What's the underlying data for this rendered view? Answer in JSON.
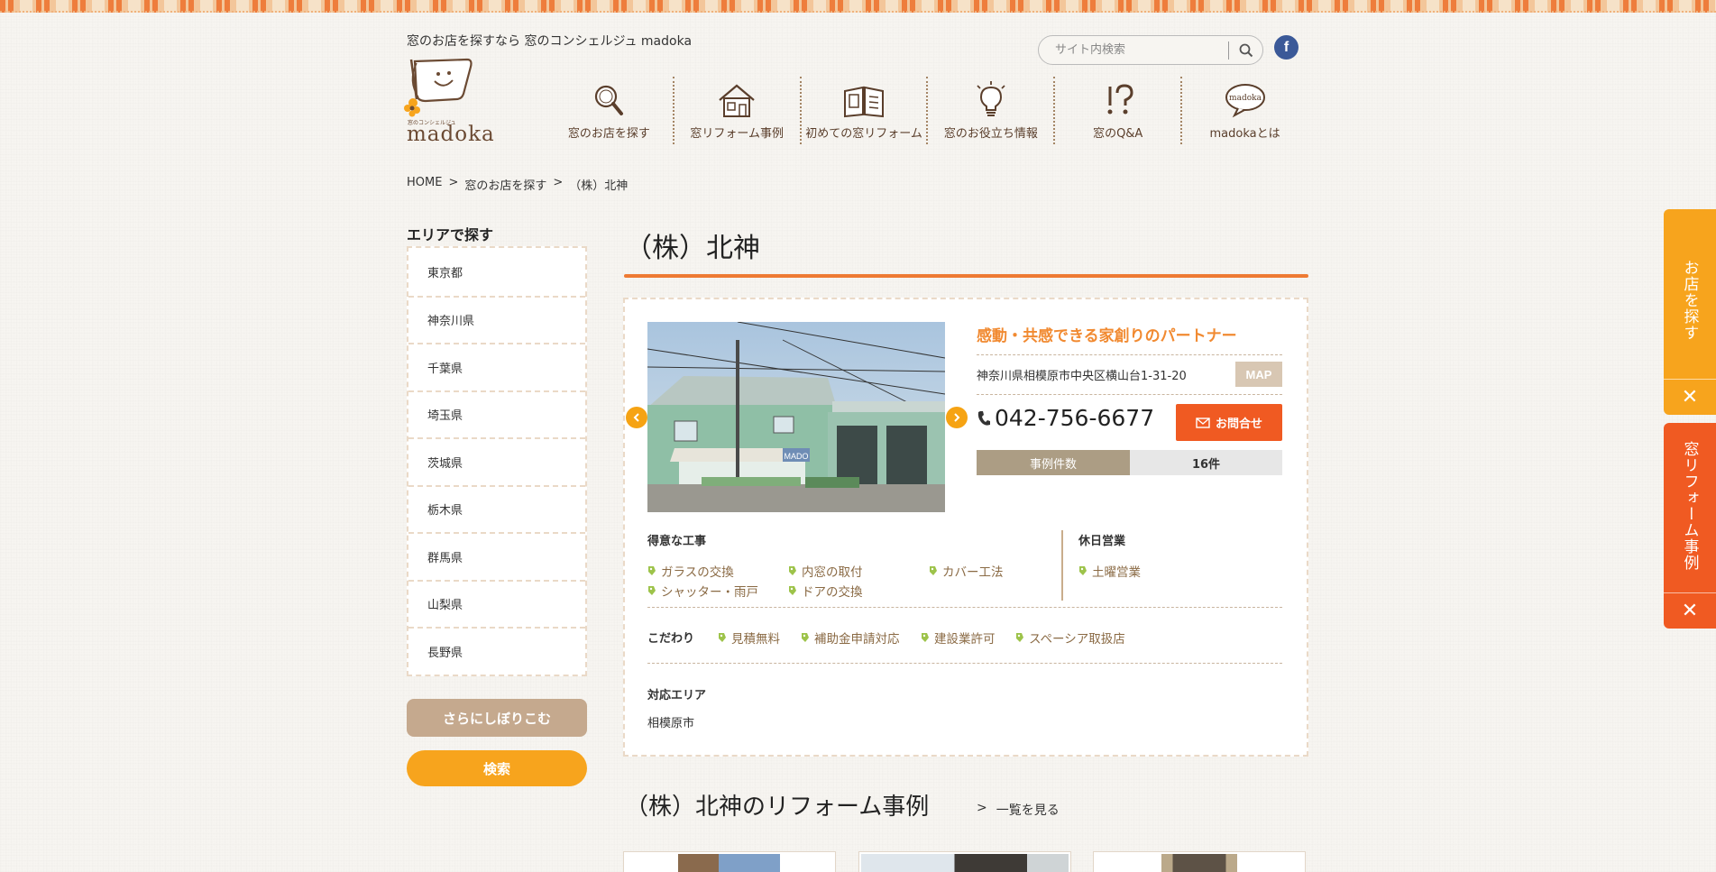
{
  "header": {
    "tagline": "窓のお店を探すなら 窓のコンシェルジュ madoka",
    "logo_text": "madoka",
    "logo_sub": "窓のコンシェルジュ",
    "search_placeholder": "サイト内検索",
    "facebook_label": "f"
  },
  "nav": [
    {
      "label": "窓のお店を探す",
      "icon": "magnifier-icon"
    },
    {
      "label": "窓リフォーム事例",
      "icon": "house-icon"
    },
    {
      "label": "初めての窓リフォーム",
      "icon": "book-icon"
    },
    {
      "label": "窓のお役立ち情報",
      "icon": "lightbulb-icon"
    },
    {
      "label": "窓のQ&A",
      "icon": "question-icon"
    },
    {
      "label": "madokaとは",
      "icon": "speech-bubble-icon",
      "bubble_text": "madoka"
    }
  ],
  "breadcrumb": {
    "home": "HOME",
    "sep": ">",
    "level1": "窓のお店を探す",
    "current": "（株）北神"
  },
  "sidebar": {
    "title": "エリアで探す",
    "areas": [
      "東京都",
      "神奈川県",
      "千葉県",
      "埼玉県",
      "茨城県",
      "栃木県",
      "群馬県",
      "山梨県",
      "長野県"
    ],
    "narrow_button": "さらにしぼりこむ",
    "search_button": "検索"
  },
  "shop": {
    "name": "（株）北神",
    "catch_copy": "感動・共感できる家創りのパートナー",
    "address": "神奈川県相模原市中央区横山台1-31-20",
    "map_button": "MAP",
    "phone": "042-756-6677",
    "contact_button": "お問合せ",
    "cases_label": "事例件数",
    "cases_count": "16件",
    "photo_sign": "MADO",
    "specialties_title": "得意な工事",
    "specialties": [
      "ガラスの交換",
      "内窓の取付",
      "カバー工法",
      "シャッター・雨戸",
      "ドアの交換"
    ],
    "holiday_title": "休日営業",
    "holiday": [
      "土曜営業"
    ],
    "commitment_title": "こだわり",
    "commitments": [
      "見積無料",
      "補助金申請対応",
      "建設業許可",
      "スペーシア取扱店"
    ],
    "area_title": "対応エリア",
    "area": "相模原市"
  },
  "cases_section": {
    "heading": "（株）北神のリフォーム事例",
    "see_all_arrow": ">",
    "see_all": "一覧を見る"
  },
  "float_tabs": [
    {
      "label": "お店を探す",
      "color": "#f7a41d"
    },
    {
      "label": "窓リフォーム事例",
      "color": "#f05a22"
    }
  ],
  "colors": {
    "accent_orange": "#f18a31",
    "title_underline": "#ee7a33",
    "contact_red": "#f05a22",
    "tag_green": "#9dc34a",
    "tag_text": "#8a6a44"
  }
}
